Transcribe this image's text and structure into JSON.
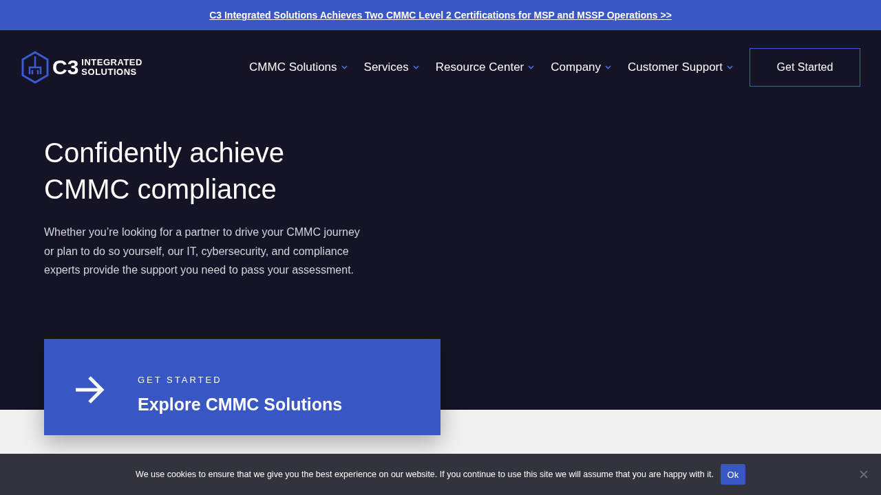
{
  "announcement": {
    "text": "C3 Integrated Solutions Achieves Two CMMC Level 2 Certifications for MSP and MSSP Operations >>"
  },
  "logo": {
    "mark": "C3",
    "lines": [
      "INTEGRATED",
      "SOLUTIONS"
    ]
  },
  "nav": [
    {
      "label": "CMMC Solutions",
      "has_menu": true
    },
    {
      "label": "Services",
      "has_menu": true
    },
    {
      "label": "Resource Center",
      "has_menu": true
    },
    {
      "label": "Company",
      "has_menu": true
    },
    {
      "label": "Customer Support",
      "has_menu": true
    }
  ],
  "header_button": "Get Started",
  "hero": {
    "title": [
      "Confidently achieve",
      "CMMC compliance"
    ],
    "body": "Whether you’re looking for a partner to drive your CMMC journey or plan to do so yourself, our IT, cybersecurity, and compliance experts provide the support you need to pass your assessment."
  },
  "cta_card": {
    "eyebrow": "GET STARTED",
    "title": "Explore CMMC Solutions"
  },
  "cookie_bar": {
    "text": "We use cookies to ensure that we give you the best experience on our website. If you continue to use this site we will assume that you are happy with it.",
    "button": "Ok"
  }
}
